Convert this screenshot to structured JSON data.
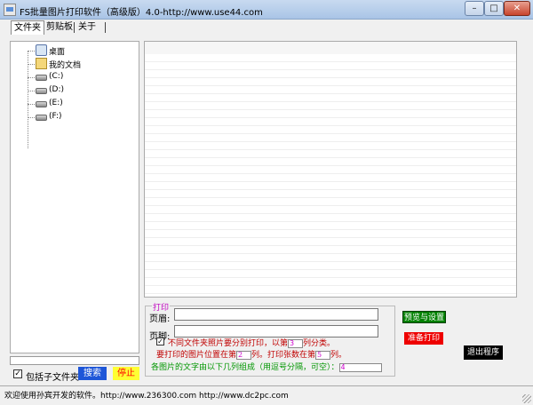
{
  "window": {
    "title": "FS批量图片打印软件（高级版）4.0-http://www.use44.com",
    "min_glyph": "–",
    "max_glyph": "□",
    "close_glyph": "✕"
  },
  "tabs": [
    {
      "label": "文件夹",
      "active": true
    },
    {
      "label": "剪贴板",
      "active": false
    },
    {
      "label": "关于",
      "active": false
    }
  ],
  "tree": {
    "items": [
      {
        "label": "桌面",
        "icon": "desktop-icon"
      },
      {
        "label": "我的文档",
        "icon": "folder-icon"
      },
      {
        "label": "(C:)",
        "icon": "drive-icon"
      },
      {
        "label": "(D:)",
        "icon": "drive-icon"
      },
      {
        "label": "(E:)",
        "icon": "drive-icon"
      },
      {
        "label": "(F:)",
        "icon": "drive-icon"
      }
    ]
  },
  "left_controls": {
    "include_subfolders_label": "包括子文件夹",
    "include_subfolders_checked": true,
    "search_label": "搜索",
    "stop_label": "停止"
  },
  "print": {
    "group_label": "打印",
    "header_label": "页眉:",
    "header_value": "",
    "footer_label": "页脚:",
    "footer_value": "",
    "separate_checked": true,
    "separate_text_before": "不同文件夹照片要分别打印，以第",
    "separate_value": "3",
    "separate_text_after": "列分类。",
    "position_text_1": "要打印的图片位置在第",
    "position_value": "2",
    "position_text_2": "列。打印张数在第",
    "count_value": "5",
    "position_text_3": "列。",
    "text_prompt": "各图片的文字由以下几列组成（用逗号分隔，可空）：",
    "text_value": "4"
  },
  "buttons": {
    "preview_label": "预览与设置",
    "prepare_label": "准备打印",
    "exit_label": "退出程序"
  },
  "status": {
    "text": "欢迎使用孙宾开发的软件。http://www.236300.com http://www.dc2pc.com"
  },
  "colors": {
    "search_bg": "#1e56d8",
    "stop_bg": "#ffff33",
    "preview_bg": "#008000",
    "prepare_bg": "#ee0000",
    "exit_bg": "#000000",
    "print_group_label": "#c000c0"
  }
}
